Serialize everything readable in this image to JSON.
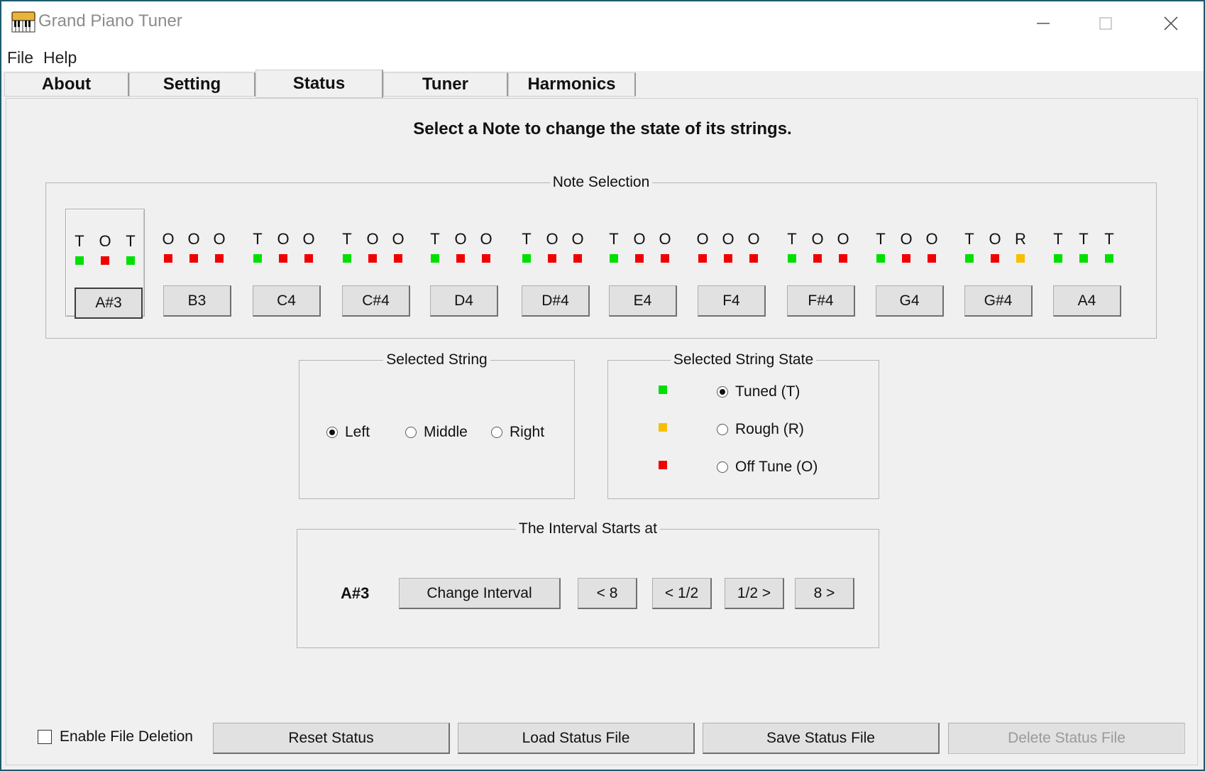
{
  "window": {
    "title": "Grand Piano Tuner",
    "menu": [
      "File",
      "Help"
    ]
  },
  "tabs": [
    {
      "label": "About",
      "active": false
    },
    {
      "label": "Setting",
      "active": false
    },
    {
      "label": "Status",
      "active": true
    },
    {
      "label": "Tuner",
      "active": false
    },
    {
      "label": "Harmonics",
      "active": false
    }
  ],
  "instruction": "Select a Note to change the state of its strings.",
  "state_colors": {
    "T": "#00e000",
    "O": "#f00000",
    "R": "#f5c000"
  },
  "note_selection": {
    "title": "Note Selection",
    "selected_note": "A#3",
    "notes": [
      {
        "label": "A#3",
        "states": [
          "T",
          "O",
          "T"
        ]
      },
      {
        "label": "B3",
        "states": [
          "O",
          "O",
          "O"
        ]
      },
      {
        "label": "C4",
        "states": [
          "T",
          "O",
          "O"
        ]
      },
      {
        "label": "C#4",
        "states": [
          "T",
          "O",
          "O"
        ]
      },
      {
        "label": "D4",
        "states": [
          "T",
          "O",
          "O"
        ]
      },
      {
        "label": "D#4",
        "states": [
          "T",
          "O",
          "O"
        ]
      },
      {
        "label": "E4",
        "states": [
          "T",
          "O",
          "O"
        ]
      },
      {
        "label": "F4",
        "states": [
          "O",
          "O",
          "O"
        ]
      },
      {
        "label": "F#4",
        "states": [
          "T",
          "O",
          "O"
        ]
      },
      {
        "label": "G4",
        "states": [
          "T",
          "O",
          "O"
        ]
      },
      {
        "label": "G#4",
        "states": [
          "T",
          "O",
          "R"
        ]
      },
      {
        "label": "A4",
        "states": [
          "T",
          "T",
          "T"
        ]
      }
    ]
  },
  "selected_string": {
    "title": "Selected String",
    "options": [
      "Left",
      "Middle",
      "Right"
    ],
    "selected": "Left"
  },
  "selected_string_state": {
    "title": "Selected String State",
    "options": [
      {
        "label": "Tuned (T)",
        "state": "T",
        "checked": true
      },
      {
        "label": "Rough (R)",
        "state": "R",
        "checked": false
      },
      {
        "label": "Off Tune (O)",
        "state": "O",
        "checked": false
      }
    ]
  },
  "interval": {
    "title": "The Interval Starts at",
    "start_note": "A#3",
    "change_label": "Change Interval",
    "buttons": [
      "< 8",
      "< 1/2",
      "1/2 >",
      "8 >"
    ]
  },
  "bottom": {
    "enable_deletion_label": "Enable File Deletion",
    "enable_deletion_checked": false,
    "reset_label": "Reset Status",
    "load_label": "Load Status File",
    "save_label": "Save Status File",
    "delete_label": "Delete Status File"
  }
}
